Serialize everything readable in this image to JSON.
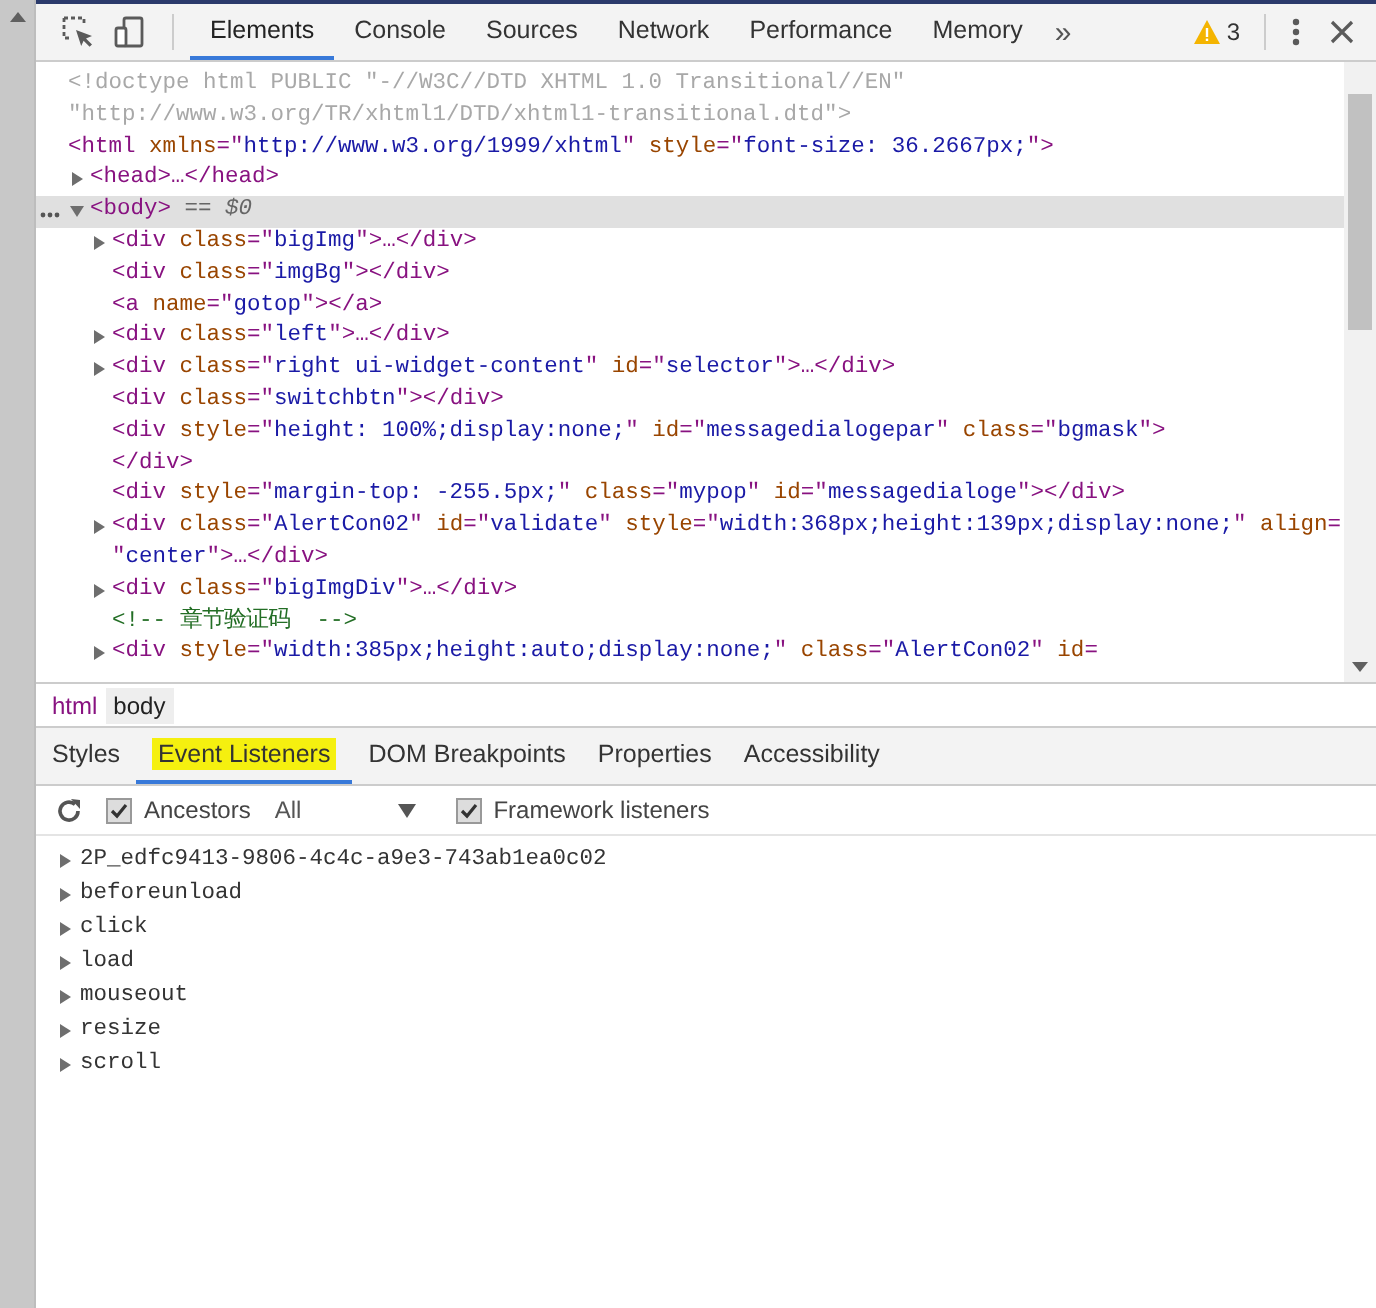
{
  "toolbar": {
    "tabs": [
      {
        "label": "Elements",
        "selected": true
      },
      {
        "label": "Console",
        "selected": false
      },
      {
        "label": "Sources",
        "selected": false
      },
      {
        "label": "Network",
        "selected": false
      },
      {
        "label": "Performance",
        "selected": false
      },
      {
        "label": "Memory",
        "selected": false
      }
    ],
    "more": "»",
    "warning_count": "3"
  },
  "tree": [
    {
      "selected": false,
      "lines": [
        [
          {
            "kind": "doctype",
            "text": "<!doctype html PUBLIC \"-//W3C//DTD XHTML 1.0 Transitional//EN\""
          }
        ],
        [
          {
            "kind": "doctype",
            "text": "\"http://www.w3.org/TR/xhtml1/DTD/xhtml1-transitional.dtd\">"
          }
        ]
      ]
    },
    {
      "selected": false,
      "lines": [
        [
          {
            "kind": "tag",
            "text": "<html"
          },
          {
            "kind": "attr",
            "text": " xmlns"
          },
          {
            "kind": "tag",
            "text": "=\""
          },
          {
            "kind": "value",
            "text": "http://www.w3.org/1999/xhtml"
          },
          {
            "kind": "tag",
            "text": "\""
          },
          {
            "kind": "attr",
            "text": " style"
          },
          {
            "kind": "tag",
            "text": "=\""
          },
          {
            "kind": "value",
            "text": "font-size: 36.2667px;"
          },
          {
            "kind": "tag",
            "text": "\">"
          }
        ]
      ],
      "children": [
        {
          "selected": false,
          "expanded": false,
          "lines": [
            [
              {
                "kind": "tag",
                "text": "<head>…</head>"
              }
            ]
          ]
        },
        {
          "selected": true,
          "expanded": true,
          "lines": [
            [
              {
                "kind": "tag",
                "text": "<body>"
              },
              {
                "kind": "marker",
                "text": " == $0"
              }
            ]
          ],
          "children": [
            {
              "selected": false,
              "expanded": false,
              "lines": [
                [
                  {
                    "kind": "tag",
                    "text": "<div"
                  },
                  {
                    "kind": "attr",
                    "text": " class"
                  },
                  {
                    "kind": "tag",
                    "text": "=\""
                  },
                  {
                    "kind": "value",
                    "text": "bigImg"
                  },
                  {
                    "kind": "tag",
                    "text": "\">…</div>"
                  }
                ]
              ]
            },
            {
              "selected": false,
              "lines": [
                [
                  {
                    "kind": "tag",
                    "text": "<div"
                  },
                  {
                    "kind": "attr",
                    "text": " class"
                  },
                  {
                    "kind": "tag",
                    "text": "=\""
                  },
                  {
                    "kind": "value",
                    "text": "imgBg"
                  },
                  {
                    "kind": "tag",
                    "text": "\"></div>"
                  }
                ]
              ]
            },
            {
              "selected": false,
              "lines": [
                [
                  {
                    "kind": "tag",
                    "text": "<a"
                  },
                  {
                    "kind": "attr",
                    "text": " name"
                  },
                  {
                    "kind": "tag",
                    "text": "=\""
                  },
                  {
                    "kind": "value",
                    "text": "gotop"
                  },
                  {
                    "kind": "tag",
                    "text": "\"></a>"
                  }
                ]
              ]
            },
            {
              "selected": false,
              "expanded": false,
              "lines": [
                [
                  {
                    "kind": "tag",
                    "text": "<div"
                  },
                  {
                    "kind": "attr",
                    "text": " class"
                  },
                  {
                    "kind": "tag",
                    "text": "=\""
                  },
                  {
                    "kind": "value",
                    "text": "left"
                  },
                  {
                    "kind": "tag",
                    "text": "\">…</div>"
                  }
                ]
              ]
            },
            {
              "selected": false,
              "expanded": false,
              "lines": [
                [
                  {
                    "kind": "tag",
                    "text": "<div"
                  },
                  {
                    "kind": "attr",
                    "text": " class"
                  },
                  {
                    "kind": "tag",
                    "text": "=\""
                  },
                  {
                    "kind": "value",
                    "text": "right ui-widget-content"
                  },
                  {
                    "kind": "tag",
                    "text": "\""
                  },
                  {
                    "kind": "attr",
                    "text": " id"
                  },
                  {
                    "kind": "tag",
                    "text": "=\""
                  },
                  {
                    "kind": "value",
                    "text": "selector"
                  },
                  {
                    "kind": "tag",
                    "text": "\">…</div>"
                  }
                ]
              ]
            },
            {
              "selected": false,
              "lines": [
                [
                  {
                    "kind": "tag",
                    "text": "<div"
                  },
                  {
                    "kind": "attr",
                    "text": " class"
                  },
                  {
                    "kind": "tag",
                    "text": "=\""
                  },
                  {
                    "kind": "value",
                    "text": "switchbtn"
                  },
                  {
                    "kind": "tag",
                    "text": "\"></div>"
                  }
                ]
              ]
            },
            {
              "selected": false,
              "lines": [
                [
                  {
                    "kind": "tag",
                    "text": "<div"
                  },
                  {
                    "kind": "attr",
                    "text": " style"
                  },
                  {
                    "kind": "tag",
                    "text": "=\""
                  },
                  {
                    "kind": "value",
                    "text": "height: 100%;display:none;"
                  },
                  {
                    "kind": "tag",
                    "text": "\""
                  },
                  {
                    "kind": "attr",
                    "text": " id"
                  },
                  {
                    "kind": "tag",
                    "text": "=\""
                  },
                  {
                    "kind": "value",
                    "text": "messagedialogepar"
                  },
                  {
                    "kind": "tag",
                    "text": "\""
                  },
                  {
                    "kind": "attr",
                    "text": " class"
                  },
                  {
                    "kind": "tag",
                    "text": "=\""
                  },
                  {
                    "kind": "value",
                    "text": "bgmask"
                  },
                  {
                    "kind": "tag",
                    "text": "\">"
                  }
                ],
                [
                  {
                    "kind": "tag",
                    "text": "</div>"
                  }
                ]
              ]
            },
            {
              "selected": false,
              "lines": [
                [
                  {
                    "kind": "tag",
                    "text": "<div"
                  },
                  {
                    "kind": "attr",
                    "text": " style"
                  },
                  {
                    "kind": "tag",
                    "text": "=\""
                  },
                  {
                    "kind": "value",
                    "text": "margin-top: -255.5px;"
                  },
                  {
                    "kind": "tag",
                    "text": "\""
                  },
                  {
                    "kind": "attr",
                    "text": " class"
                  },
                  {
                    "kind": "tag",
                    "text": "=\""
                  },
                  {
                    "kind": "value",
                    "text": "mypop"
                  },
                  {
                    "kind": "tag",
                    "text": "\""
                  },
                  {
                    "kind": "attr",
                    "text": " id"
                  },
                  {
                    "kind": "tag",
                    "text": "=\""
                  },
                  {
                    "kind": "value",
                    "text": "messagedialoge"
                  },
                  {
                    "kind": "tag",
                    "text": "\"></div>"
                  }
                ]
              ]
            },
            {
              "selected": false,
              "expanded": false,
              "lines": [
                [
                  {
                    "kind": "tag",
                    "text": "<div"
                  },
                  {
                    "kind": "attr",
                    "text": " class"
                  },
                  {
                    "kind": "tag",
                    "text": "=\""
                  },
                  {
                    "kind": "value",
                    "text": "AlertCon02"
                  },
                  {
                    "kind": "tag",
                    "text": "\""
                  },
                  {
                    "kind": "attr",
                    "text": " id"
                  },
                  {
                    "kind": "tag",
                    "text": "=\""
                  },
                  {
                    "kind": "value",
                    "text": "validate"
                  },
                  {
                    "kind": "tag",
                    "text": "\""
                  },
                  {
                    "kind": "attr",
                    "text": " style"
                  },
                  {
                    "kind": "tag",
                    "text": "=\""
                  },
                  {
                    "kind": "value",
                    "text": "width:368px;height:139px;display:none;"
                  },
                  {
                    "kind": "tag",
                    "text": "\""
                  },
                  {
                    "kind": "attr",
                    "text": " align"
                  },
                  {
                    "kind": "tag",
                    "text": "="
                  }
                ],
                [
                  {
                    "kind": "tag",
                    "text": "\""
                  },
                  {
                    "kind": "value",
                    "text": "center"
                  },
                  {
                    "kind": "tag",
                    "text": "\">…</div>"
                  }
                ]
              ]
            },
            {
              "selected": false,
              "expanded": false,
              "lines": [
                [
                  {
                    "kind": "tag",
                    "text": "<div"
                  },
                  {
                    "kind": "attr",
                    "text": " class"
                  },
                  {
                    "kind": "tag",
                    "text": "=\""
                  },
                  {
                    "kind": "value",
                    "text": "bigImgDiv"
                  },
                  {
                    "kind": "tag",
                    "text": "\">…</div>"
                  }
                ]
              ]
            },
            {
              "selected": false,
              "lines": [
                [
                  {
                    "kind": "comment",
                    "text": "<!-- 章节验证码  -->"
                  }
                ]
              ]
            },
            {
              "selected": false,
              "expanded": false,
              "lines": [
                [
                  {
                    "kind": "tag",
                    "text": "<div"
                  },
                  {
                    "kind": "attr",
                    "text": " style"
                  },
                  {
                    "kind": "tag",
                    "text": "=\""
                  },
                  {
                    "kind": "value",
                    "text": "width:385px;height:auto;display:none;"
                  },
                  {
                    "kind": "tag",
                    "text": "\""
                  },
                  {
                    "kind": "attr",
                    "text": " class"
                  },
                  {
                    "kind": "tag",
                    "text": "=\""
                  },
                  {
                    "kind": "value",
                    "text": "AlertCon02"
                  },
                  {
                    "kind": "tag",
                    "text": "\""
                  },
                  {
                    "kind": "attr",
                    "text": " id"
                  },
                  {
                    "kind": "tag",
                    "text": "="
                  }
                ]
              ]
            }
          ]
        }
      ]
    }
  ],
  "breadcrumbs": [
    {
      "label": "html",
      "selected": false
    },
    {
      "label": "body",
      "selected": true
    }
  ],
  "sidebar_tabs": [
    {
      "label": "Styles",
      "selected": false,
      "search_match": false
    },
    {
      "label": "Event Listeners",
      "selected": true,
      "search_match": true
    },
    {
      "label": "DOM Breakpoints",
      "selected": false,
      "search_match": false
    },
    {
      "label": "Properties",
      "selected": false,
      "search_match": false
    },
    {
      "label": "Accessibility",
      "selected": false,
      "search_match": false
    }
  ],
  "filters": {
    "ancestors": {
      "label": "Ancestors",
      "checked": true
    },
    "scope": "All",
    "framework": {
      "label": "Framework listeners",
      "checked": true
    }
  },
  "listeners": [
    {
      "name": "2P_edfc9413-9806-4c4c-a9e3-743ab1ea0c02",
      "expanded": false
    },
    {
      "name": "beforeunload",
      "expanded": false
    },
    {
      "name": "click",
      "expanded": false
    },
    {
      "name": "load",
      "expanded": false
    },
    {
      "name": "mouseout",
      "expanded": false
    },
    {
      "name": "resize",
      "expanded": false
    },
    {
      "name": "scroll",
      "expanded": false
    }
  ]
}
